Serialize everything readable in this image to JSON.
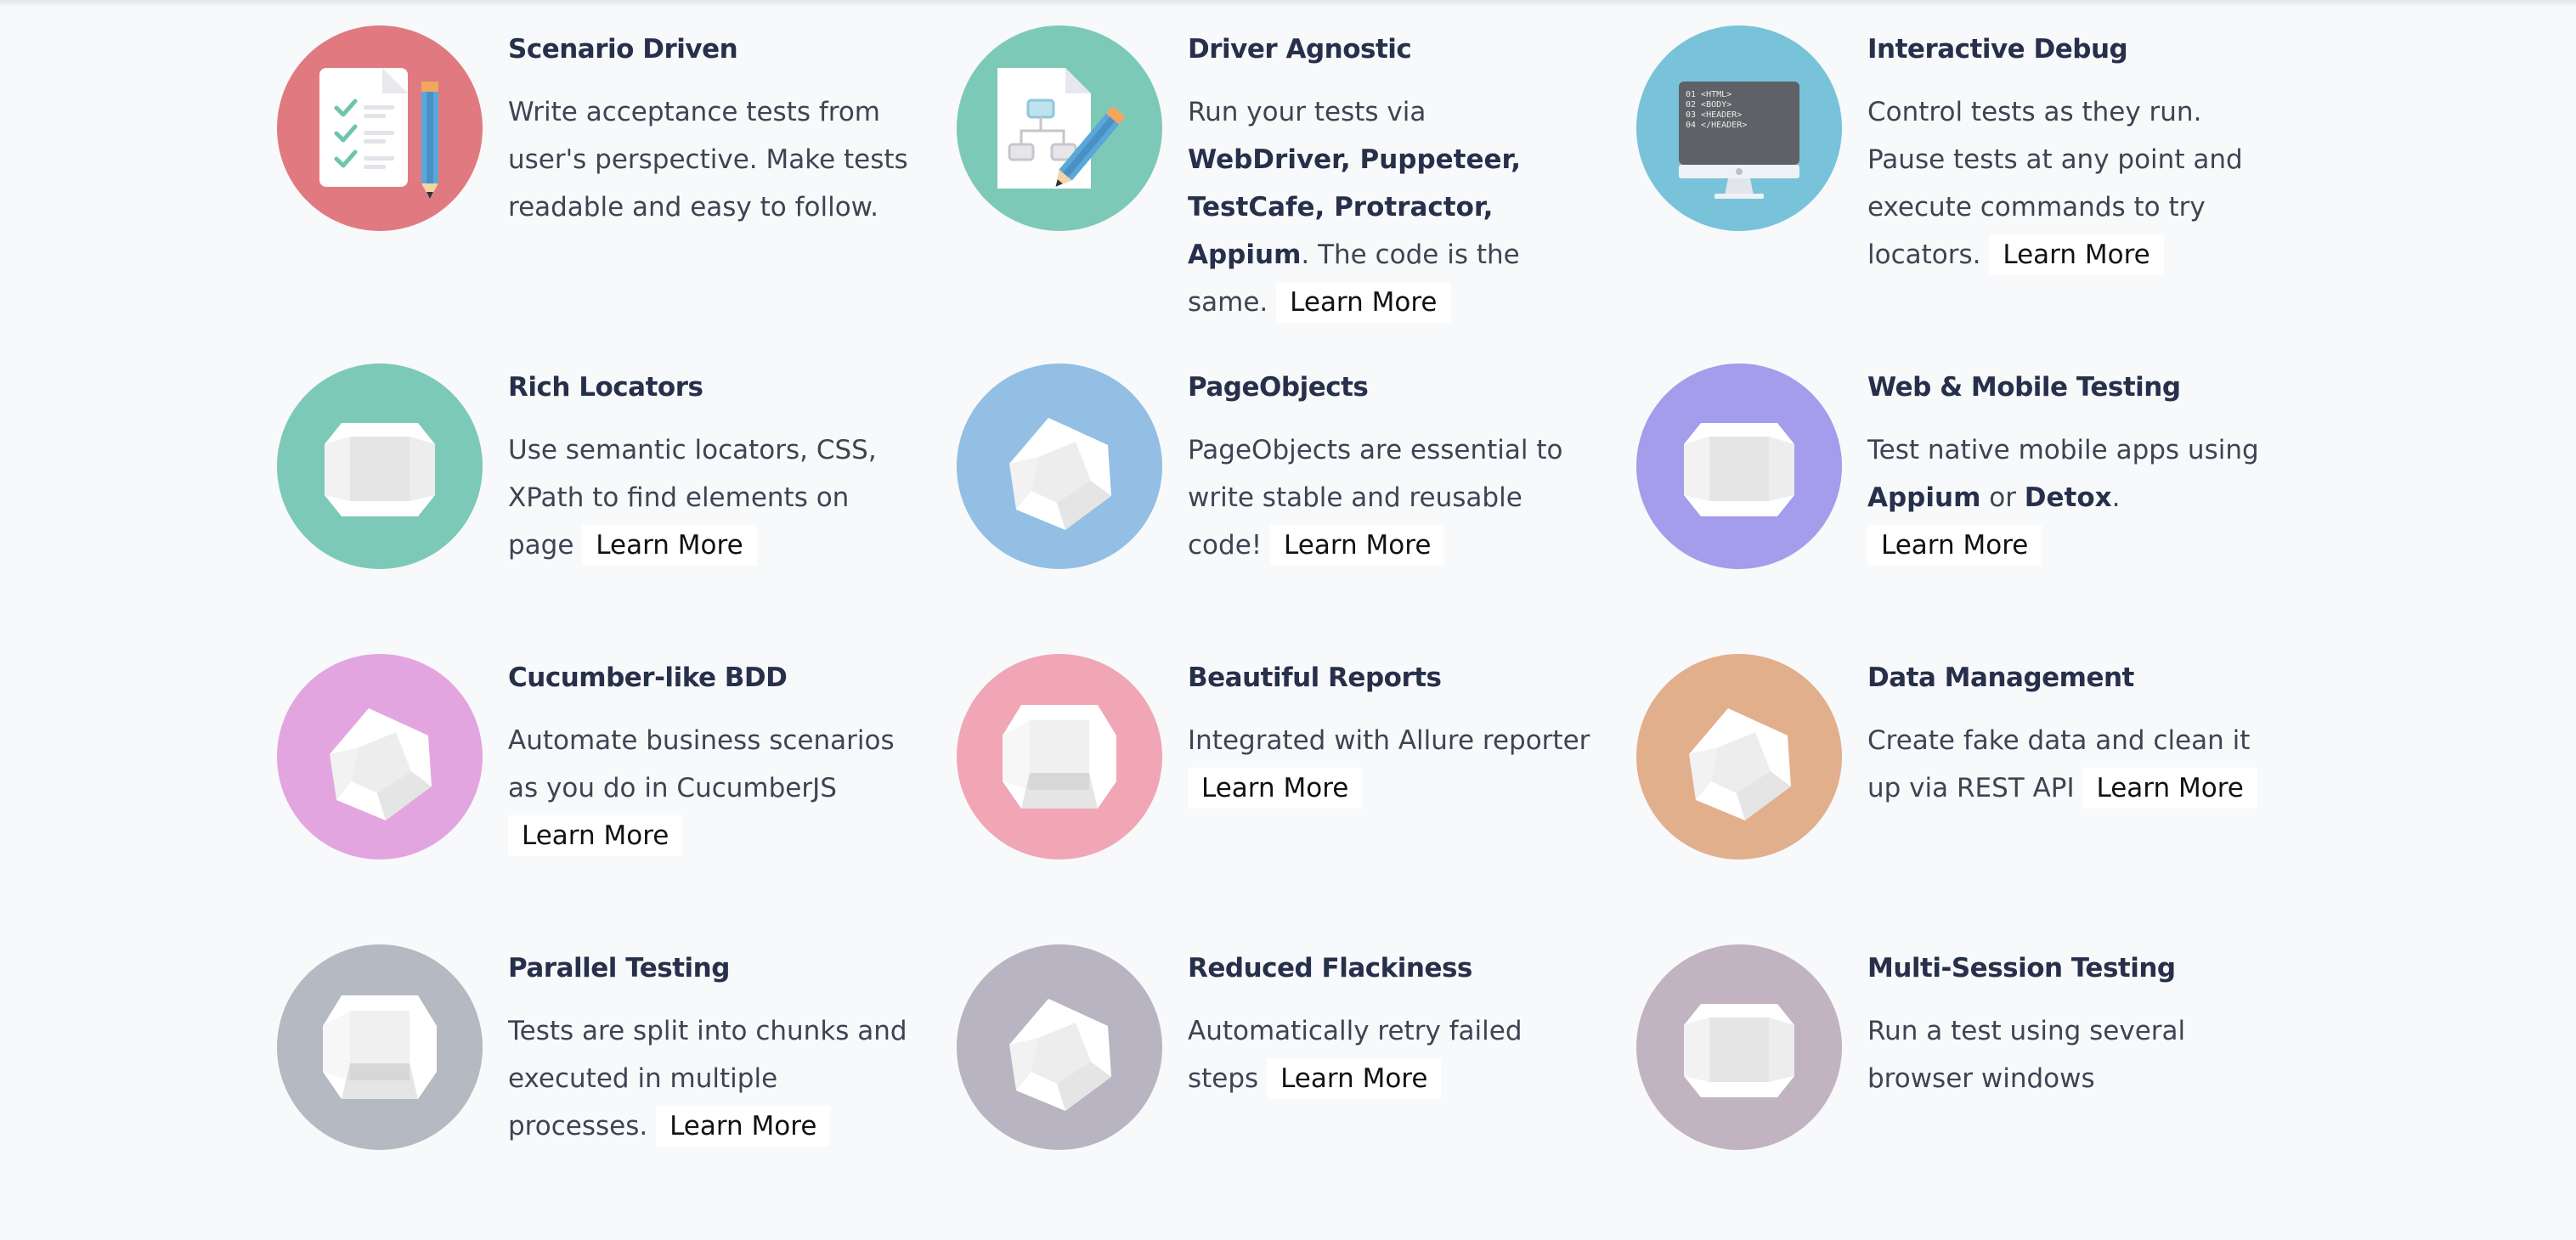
{
  "learn_more_label": "Learn More",
  "features": [
    {
      "title": "Scenario Driven",
      "icon": "checklist-document-icon",
      "color": "#e07a80",
      "desc": [
        {
          "t": "Write acceptance tests from user's perspective. Make tests readable and easy to follow."
        }
      ],
      "has_learn": false
    },
    {
      "title": "Driver Agnostic",
      "icon": "diagram-document-icon",
      "color": "#7dc9b8",
      "desc": [
        {
          "t": "Run your tests via "
        },
        {
          "t": "WebDriver, Puppeteer, TestCafe, Protractor, Appium",
          "b": true
        },
        {
          "t": ". The code is the same."
        }
      ],
      "has_learn": true
    },
    {
      "title": "Interactive Debug",
      "icon": "monitor-code-icon",
      "color": "#78c3da",
      "desc": [
        {
          "t": "Control tests as they run. Pause tests at any point and execute commands to try locators."
        }
      ],
      "has_learn": true
    },
    {
      "title": "Rich Locators",
      "icon": "hexagon-gem-icon",
      "color": "#7dc9b8",
      "desc": [
        {
          "t": "Use semantic locators, CSS, XPath to find elements on page"
        }
      ],
      "has_learn": true
    },
    {
      "title": "PageObjects",
      "icon": "tilted-gem-icon",
      "color": "#92bfe3",
      "desc": [
        {
          "t": "PageObjects are essential to write stable and reusable code!"
        }
      ],
      "has_learn": true
    },
    {
      "title": "Web & Mobile Testing",
      "icon": "hexagon-gem-icon",
      "color": "#a39deb",
      "desc": [
        {
          "t": "Test native mobile apps using "
        },
        {
          "t": "Appium",
          "b": true
        },
        {
          "t": " or "
        },
        {
          "t": "Detox",
          "b": true
        },
        {
          "t": "."
        }
      ],
      "has_learn": true
    },
    {
      "title": "Cucumber-like BDD",
      "icon": "tilted-gem-icon",
      "color": "#e3a5e0",
      "desc": [
        {
          "t": "Automate business scenarios as you do in CucumberJS"
        }
      ],
      "has_learn": true
    },
    {
      "title": "Beautiful Reports",
      "icon": "flat-gem-icon",
      "color": "#f0a6b5",
      "desc": [
        {
          "t": "Integrated with Allure reporter"
        }
      ],
      "has_learn": true
    },
    {
      "title": "Data Management",
      "icon": "tilted-gem-icon",
      "color": "#e2af8c",
      "desc": [
        {
          "t": "Create fake data and clean it up via REST API"
        }
      ],
      "has_learn": true
    },
    {
      "title": "Parallel Testing",
      "icon": "flat-gem-icon",
      "color": "#b4b9c2",
      "desc": [
        {
          "t": "Tests are split into chunks and executed in multiple processes."
        }
      ],
      "has_learn": true
    },
    {
      "title": "Reduced Flackiness",
      "icon": "tilted-gem-icon",
      "color": "#b9b4c1",
      "desc": [
        {
          "t": "Automatically retry failed steps"
        }
      ],
      "has_learn": true
    },
    {
      "title": "Multi-Session Testing",
      "icon": "hexagon-gem-icon",
      "color": "#c1b3bf",
      "desc": [
        {
          "t": "Run a test using several browser windows"
        }
      ],
      "has_learn": false
    }
  ]
}
